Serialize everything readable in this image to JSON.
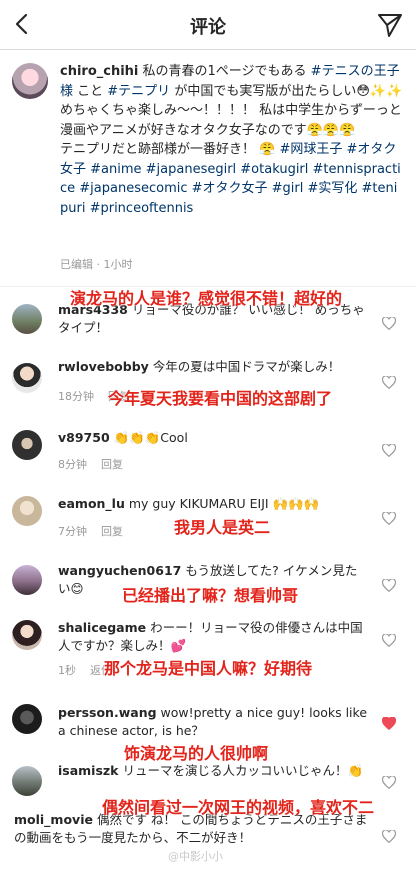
{
  "header": {
    "title": "评论"
  },
  "caption": {
    "username": "chiro_chihi",
    "parts": [
      {
        "t": " 私の青春の1ページでもある ",
        "h": false
      },
      {
        "t": "#テニスの王子様",
        "h": true
      },
      {
        "t": " こと ",
        "h": false
      },
      {
        "t": "#テニプリ",
        "h": true
      },
      {
        "t": " が中国でも実写版が出たらしい😳✨✨",
        "h": false
      },
      {
        "t": "\nめちゃくちゃ楽しみ～～！！！！ 私は中学生からずーっと漫画やアニメが好きなオタク女子なのです😤😤😤\nテニプリだと跡部様が一番好き！ 😤 ",
        "h": false
      },
      {
        "t": "#网球王子 #オタク女子 #anime #japanesegirl #otakugirl #tennispractice #japanesecomic #オタク女子 #girl #实写化 #tenipuri #princeoftennis",
        "h": true
      }
    ],
    "meta": "已编辑 · 1小时"
  },
  "comments": [
    {
      "username": "mars4338",
      "text": " リョーマ役のが誰？ いい感じ！ めっちゃタイプ！",
      "time": "",
      "reply": "",
      "liked": false
    },
    {
      "username": "rwlovebobby",
      "text": " 今年の夏は中国ドラマが楽しみ！",
      "time": "18分钟",
      "reply": "回复",
      "liked": false
    },
    {
      "username": "v89750",
      "text": " 👏👏👏Cool",
      "time": "8分钟",
      "reply": "回复",
      "liked": false
    },
    {
      "username": "eamon_lu",
      "text": " my guy KIKUMARU EIJI 🙌🙌🙌",
      "time": "7分钟",
      "reply": "回复",
      "liked": false
    },
    {
      "username": "wangyuchen0617",
      "text": " もう放送してた? イケメン見たい😊",
      "time": "",
      "reply": "",
      "liked": false
    },
    {
      "username": "shalicegame",
      "text": " わーー！リョーマ役の俳優さんは中国人ですか？楽しみ！💕",
      "time": "1秒",
      "reply": "返信",
      "liked": false
    },
    {
      "username": "persson.wang",
      "text": " wow!pretty a nice guy! looks like a chinese actor, is he？",
      "time": "",
      "reply": "",
      "liked": true
    },
    {
      "username": "isamiszk",
      "text": " リューマを演じる人カッコいいじゃん！👏",
      "time": "",
      "reply": "",
      "liked": false
    },
    {
      "username": "moli_movie",
      "text": " 偶然です ね！ この間ちょうどテニスの王子さまの動画をもう一度見たから、不二が好き！",
      "time": "",
      "reply": "",
      "liked": false
    }
  ],
  "translations": [
    "演龙马的人是谁？感觉很不错！超好的",
    "今年夏天我要看中国的这部剧了",
    "我男人是英二",
    "已经播出了嘛？想看帅哥",
    "那个龙马是中国人嘛？好期待",
    "饰演龙马的人很帅啊",
    "偶然间看过一次网王的视频，喜欢不二"
  ],
  "watermark": "@中影小小",
  "colors": {
    "overlay_red": "#e3241b",
    "hashtag": "#003569",
    "liked_heart": "#ed4956"
  },
  "icons": [
    "back-arrow-icon",
    "send-icon",
    "heart-icon"
  ]
}
